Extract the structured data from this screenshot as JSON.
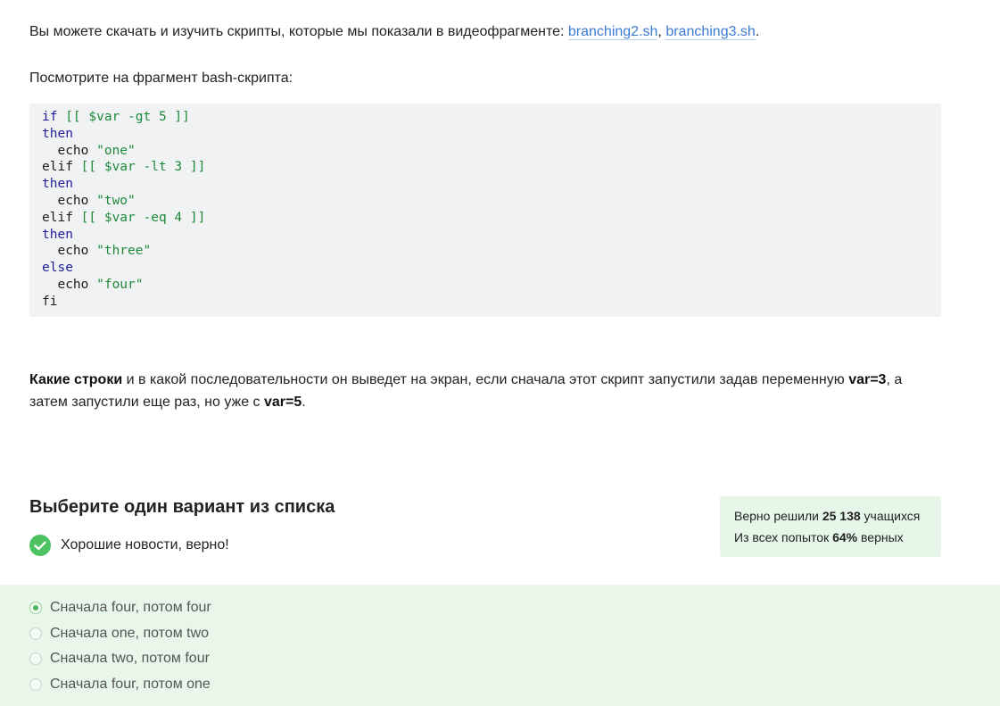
{
  "intro": {
    "text": "Вы можете скачать и изучить скрипты, которые мы показали в видеофрагменте: ",
    "link1": "branching2.sh",
    "sep": ", ",
    "link2": "branching3.sh",
    "end": "."
  },
  "lead": "Посмотрите на фрагмент bash-скрипта:",
  "code": {
    "if": "if",
    "cond1": " [[ $var -gt 5 ]]",
    "then": "then",
    "echo": "  echo ",
    "str_one": "\"one\"",
    "elif": "elif",
    "cond2": " [[ $var -lt 3 ]]",
    "str_two": "\"two\"",
    "cond3": " [[ $var -eq 4 ]]",
    "str_three": "\"three\"",
    "else": "else",
    "str_four": "\"four\"",
    "fi": "fi"
  },
  "question": {
    "bold1": "Какие строки",
    "text1": " и в какой последовательности он выведет на экран, если сначала этот скрипт запустили задав переменную ",
    "bold2": "var=3",
    "text2": ", а затем запустили еще раз, но уже с ",
    "bold3": "var=5",
    "text3": "."
  },
  "heading": "Выберите один вариант из списка",
  "success": {
    "icon": "check-circle-icon",
    "text": "Хорошие новости, верно!",
    "color": "#4cc260"
  },
  "stats": {
    "line1_prefix": "Верно решили ",
    "line1_count": "25 138",
    "line1_suffix": " учащихся",
    "line2_prefix": "Из всех попыток ",
    "line2_pct": "64%",
    "line2_suffix": " верных"
  },
  "options": [
    {
      "label": "Сначала four, потом four",
      "selected": true
    },
    {
      "label": "Сначала one, потом two",
      "selected": false
    },
    {
      "label": "Сначала two, потом four",
      "selected": false
    },
    {
      "label": "Сначала four, потом one",
      "selected": false
    }
  ]
}
